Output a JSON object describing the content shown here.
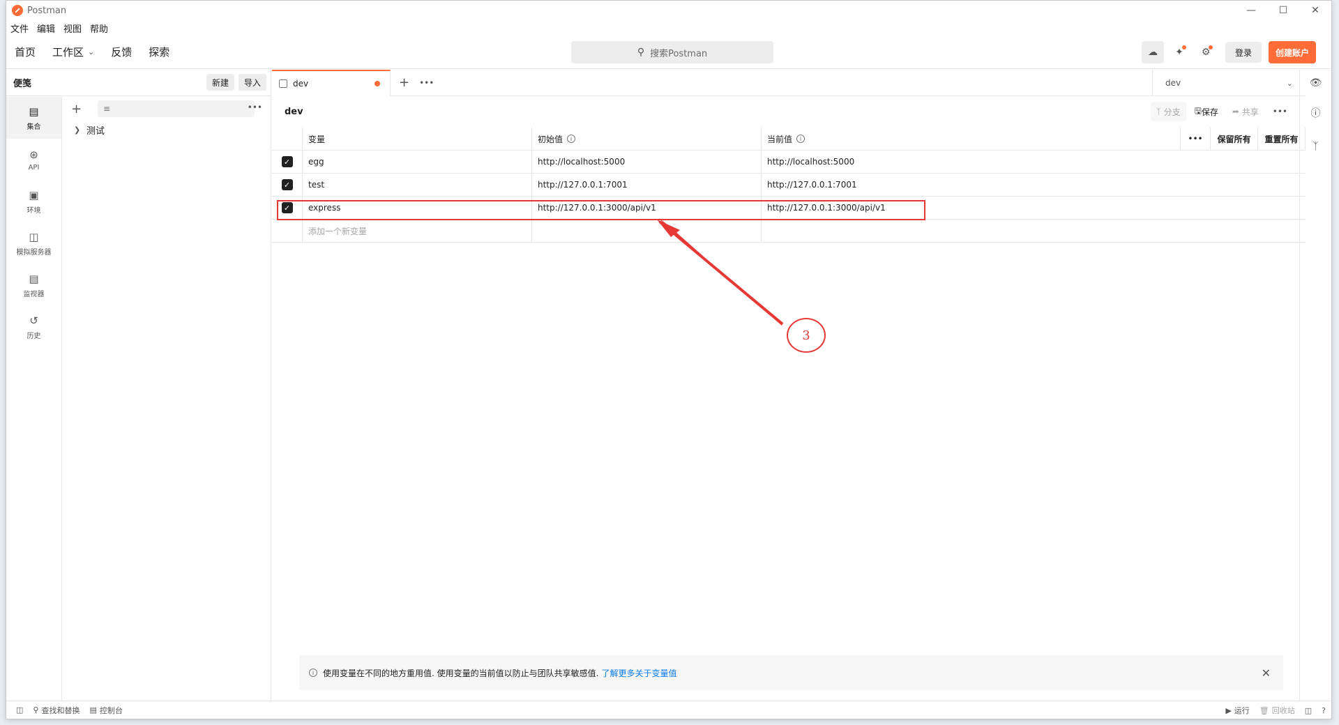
{
  "app": {
    "title": "Postman"
  },
  "menubar": [
    "文件",
    "编辑",
    "视图",
    "帮助"
  ],
  "header": {
    "nav": {
      "home": "首页",
      "workspace": "工作区",
      "feedback": "反馈",
      "explore": "探索"
    },
    "search_placeholder": "搜索Postman",
    "login": "登录",
    "create_account": "创建账户"
  },
  "sidebar": {
    "workspace_name": "便笺",
    "new_btn": "新建",
    "import_btn": "导入",
    "rail": [
      {
        "label": "集合",
        "icon": "collection-icon"
      },
      {
        "label": "API",
        "icon": "api-icon"
      },
      {
        "label": "环境",
        "icon": "environment-icon"
      },
      {
        "label": "模拟服务器",
        "icon": "mock-server-icon"
      },
      {
        "label": "监视器",
        "icon": "monitor-icon"
      },
      {
        "label": "历史",
        "icon": "history-icon"
      }
    ],
    "tree": [
      {
        "label": "测试"
      }
    ]
  },
  "tabs": {
    "active": "dev",
    "env_selector": "dev"
  },
  "environment": {
    "name": "dev",
    "actions": {
      "fork": "分支",
      "save": "保存",
      "share": "共享"
    },
    "columns": {
      "variable": "变量",
      "initial": "初始值",
      "current": "当前值",
      "keep_all": "保留所有",
      "reset_all": "重置所有"
    },
    "rows": [
      {
        "checked": true,
        "variable": "egg",
        "initial": "http://localhost:5000",
        "current": "http://localhost:5000"
      },
      {
        "checked": true,
        "variable": "test",
        "initial": "http://127.0.0.1:7001",
        "current": "http://127.0.0.1:7001"
      },
      {
        "checked": true,
        "variable": "express",
        "initial": "http://127.0.0.1:3000/api/v1",
        "current": "http://127.0.0.1:3000/api/v1"
      }
    ],
    "new_variable_placeholder": "添加一个新变量"
  },
  "annotation": {
    "number": "3",
    "color": "#e53935"
  },
  "banner": {
    "text": "使用变量在不同的地方重用值. 使用变量的当前值以防止与团队共享敏感值.",
    "link": "了解更多关于变量值"
  },
  "footer": {
    "find_replace": "查找和替换",
    "console": "控制台",
    "runner": "运行",
    "trash": "回收站"
  },
  "colors": {
    "accent": "#ff6c37",
    "link": "#097bed"
  }
}
